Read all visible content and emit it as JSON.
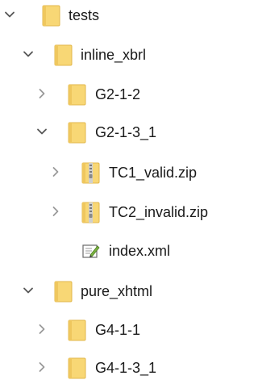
{
  "tree": {
    "items": [
      {
        "label": "tests",
        "icon": "folder-icon",
        "expanded": true
      },
      {
        "label": "inline_xbrl",
        "icon": "folder-icon",
        "expanded": true
      },
      {
        "label": "G2-1-2",
        "icon": "folder-icon",
        "expanded": false
      },
      {
        "label": "G2-1-3_1",
        "icon": "folder-icon",
        "expanded": true
      },
      {
        "label": "TC1_valid.zip",
        "icon": "zip-folder-icon",
        "expanded": false
      },
      {
        "label": "TC2_invalid.zip",
        "icon": "zip-folder-icon",
        "expanded": false
      },
      {
        "label": "index.xml",
        "icon": "xml-file-icon"
      },
      {
        "label": "pure_xhtml",
        "icon": "folder-icon",
        "expanded": true
      },
      {
        "label": "G4-1-1",
        "icon": "folder-icon",
        "expanded": false
      },
      {
        "label": "G4-1-3_1",
        "icon": "folder-icon",
        "expanded": false
      }
    ]
  },
  "colors": {
    "folder_fill": "#F8D775",
    "folder_edge": "#E2B74C",
    "zip_stripe": "#8A8A8A",
    "chevron": "#555555",
    "text": "#1A1A1A"
  }
}
